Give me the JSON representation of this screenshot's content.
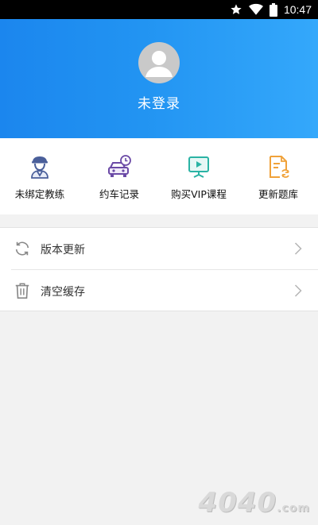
{
  "status_bar": {
    "time": "10:47",
    "icons": [
      "star-icon",
      "wifi-icon",
      "battery-icon"
    ]
  },
  "header": {
    "login_status": "未登录",
    "gradient": [
      "#1b86ee",
      "#34a8fb"
    ]
  },
  "quick_actions": [
    {
      "label": "未绑定教练",
      "icon": "coach-icon",
      "color": "#4a5f9a"
    },
    {
      "label": "约车记录",
      "icon": "car-clock-icon",
      "color": "#6b4aa6"
    },
    {
      "label": "购买VIP课程",
      "icon": "video-course-icon",
      "color": "#2ab3a4"
    },
    {
      "label": "更新题库",
      "icon": "question-bank-refresh-icon",
      "color": "#f0a23a"
    }
  ],
  "menu": [
    {
      "label": "版本更新",
      "icon": "refresh-icon"
    },
    {
      "label": "清空缓存",
      "icon": "trash-icon"
    }
  ],
  "watermark": {
    "text": "4040",
    "suffix": ".com"
  }
}
